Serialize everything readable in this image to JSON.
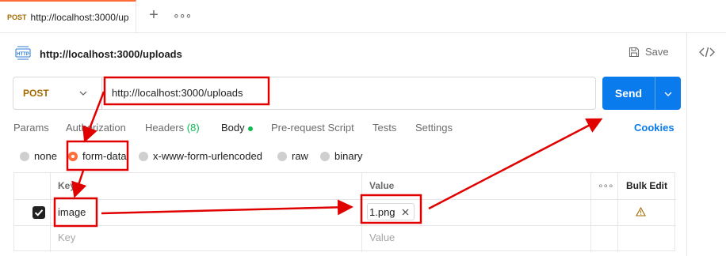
{
  "tab": {
    "method": "POST",
    "url": "http://localhost:3000/up",
    "more": "∘∘∘",
    "add": "+"
  },
  "request": {
    "title": "http://localhost:3000/uploads",
    "save_label": "Save",
    "method": "POST",
    "url": "http://localhost:3000/uploads",
    "send_label": "Send"
  },
  "subtabs": [
    {
      "label": "Params"
    },
    {
      "label": "Authorization"
    },
    {
      "label": "Headers",
      "count": "(8)"
    },
    {
      "label": "Body"
    },
    {
      "label": "Pre-request Script"
    },
    {
      "label": "Tests"
    },
    {
      "label": "Settings"
    }
  ],
  "cookies_label": "Cookies",
  "body_types": [
    "none",
    "form-data",
    "x-www-form-urlencoded",
    "raw",
    "binary"
  ],
  "selected_body_type": "form-data",
  "table": {
    "headers": {
      "key": "Key",
      "value": "Value",
      "more": "∘∘∘",
      "bulk": "Bulk Edit"
    },
    "rows": [
      {
        "checked": true,
        "key": "image",
        "value": "1.png",
        "warning": true
      }
    ],
    "placeholder_key": "Key",
    "placeholder_value": "Value"
  },
  "colors": {
    "accent": "#ff6c37",
    "send": "#097bed",
    "annotation": "#e00000",
    "method": "#a56a00"
  }
}
